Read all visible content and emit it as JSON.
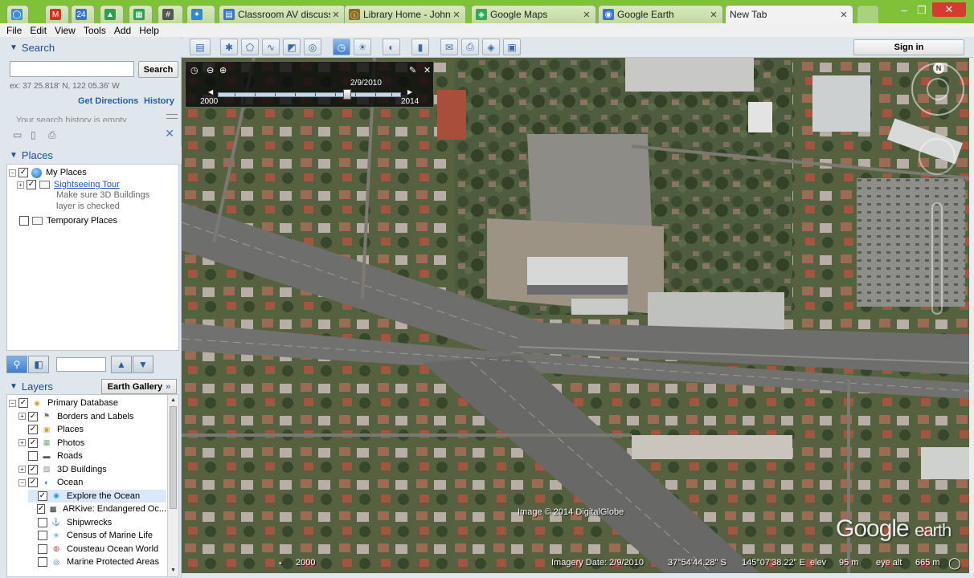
{
  "browser": {
    "tabs": [
      {
        "title": "",
        "icon": "◯",
        "color": "#3b8ed8"
      },
      {
        "title": "",
        "icon": "M",
        "color": "#d93025"
      },
      {
        "title": "",
        "icon": "24",
        "color": "#3a73d4"
      },
      {
        "title": "",
        "icon": "▲",
        "color": "#2e9e4f"
      },
      {
        "title": "",
        "icon": "▦",
        "color": "#2e9e4f"
      },
      {
        "title": "",
        "icon": "#",
        "color": "#555555"
      },
      {
        "title": "",
        "icon": "✦",
        "color": "#2a8ad8"
      },
      {
        "title": "Classroom AV discussi",
        "icon": "▤",
        "color": "#3a73d4"
      },
      {
        "title": "Library Home - John M",
        "icon": "ⓘ",
        "color": "#8a6d1e"
      },
      {
        "title": "Google Maps",
        "icon": "◈",
        "color": "#34a853"
      },
      {
        "title": "Google Earth",
        "icon": "◉",
        "color": "#3a73d4"
      },
      {
        "title": "New Tab",
        "icon": "",
        "color": "#ffffff"
      }
    ],
    "window_buttons": {
      "minimize": "–",
      "restore": "❐",
      "close": "✕"
    }
  },
  "menu": [
    "File",
    "Edit",
    "View",
    "Tools",
    "Add",
    "Help"
  ],
  "search": {
    "header": "Search",
    "button": "Search",
    "hint": "ex: 37 25.818' N, 122 05.36' W",
    "get_directions": "Get Directions",
    "history": "History",
    "faded": "Your search history is empty"
  },
  "places": {
    "header": "Places",
    "my_places": "My Places",
    "sightseeing": "Sightseeing Tour",
    "note_line1": "Make sure 3D Buildings",
    "note_line2": "layer is checked",
    "temporary": "Temporary Places"
  },
  "layers": {
    "header": "Layers",
    "gallery": "Earth Gallery",
    "gallery_arrow": "»",
    "items": [
      {
        "label": "Primary Database",
        "level": 0,
        "expander": "minus",
        "checked": true
      },
      {
        "label": "Borders and Labels",
        "level": 1,
        "expander": "plus",
        "checked": true
      },
      {
        "label": "Places",
        "level": 1,
        "expander": "none",
        "checked": true
      },
      {
        "label": "Photos",
        "level": 1,
        "expander": "plus",
        "checked": true
      },
      {
        "label": "Roads",
        "level": 1,
        "expander": "none",
        "checked": false
      },
      {
        "label": "3D Buildings",
        "level": 1,
        "expander": "plus",
        "checked": true
      },
      {
        "label": "Ocean",
        "level": 1,
        "expander": "minus",
        "checked": true
      },
      {
        "label": "Explore the Ocean",
        "level": 2,
        "expander": "none",
        "checked": true,
        "selected": true
      },
      {
        "label": "ARKive: Endangered Oc...",
        "level": 2,
        "expander": "none",
        "checked": true
      },
      {
        "label": "Shipwrecks",
        "level": 2,
        "expander": "none",
        "checked": false
      },
      {
        "label": "Census of Marine Life",
        "level": 2,
        "expander": "none",
        "checked": false
      },
      {
        "label": "Cousteau Ocean World",
        "level": 2,
        "expander": "none",
        "checked": false
      },
      {
        "label": "Marine Protected Areas",
        "level": 2,
        "expander": "none",
        "checked": false
      }
    ]
  },
  "toolbar": {
    "sign_in": "Sign in"
  },
  "time_slider": {
    "date": "2/9/2010",
    "start": "2000",
    "end": "2014"
  },
  "map": {
    "copyright": "Image © 2014 DigitalGlobe",
    "logo_google": "Google",
    "logo_earth": "earth",
    "compass_n": "N",
    "status": {
      "year": "2000",
      "imagery_date": "Imagery Date: 2/9/2010",
      "lat": "37°54'44.28\" S",
      "lon": "145°07'38.22\" E",
      "elev_label": "elev",
      "elev": "95 m",
      "eye_alt_label": "eye alt",
      "eye_alt": "665 m"
    }
  }
}
